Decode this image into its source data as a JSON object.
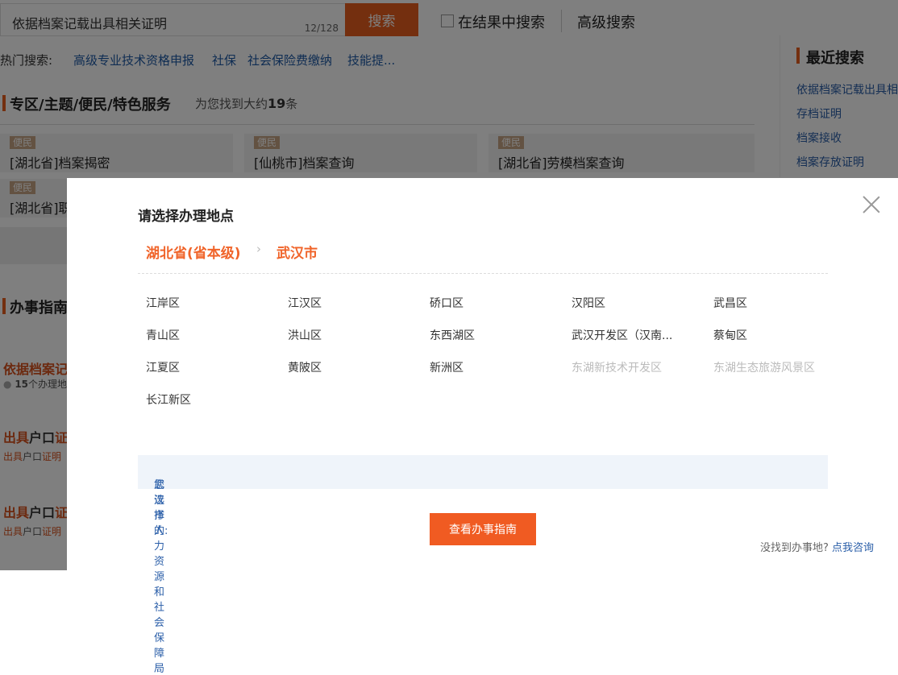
{
  "search": {
    "value": "依据档案记载出具相关证明",
    "counter": "12/128",
    "button": "搜索",
    "within_results": "在结果中搜索",
    "advanced": "高级搜索"
  },
  "hot": {
    "label": "热门搜索:",
    "links": [
      "高级专业技术资格申报",
      "社保",
      "社会保险费缴纳",
      "技能提..."
    ]
  },
  "section1": {
    "title": "专区/主题/便民/特色服务",
    "found_prefix": "为您找到大约",
    "found_count": "19",
    "found_suffix": "条"
  },
  "cards": [
    {
      "tag": "便民",
      "title": "[湖北省]档案揭密"
    },
    {
      "tag": "便民",
      "title": "[仙桃市]档案查询"
    },
    {
      "tag": "便民",
      "title": "[湖北省]劳模档案查询"
    },
    {
      "tag": "便民",
      "title": "[湖北省]职"
    }
  ],
  "section2": {
    "title": "办事指南"
  },
  "guide_items": [
    {
      "title": "依据档案记",
      "sub_count": "15",
      "sub_text": "个办理地点"
    },
    {
      "title_a": "出具",
      "title_b": "户口",
      "title_c": "证",
      "sub_a": "出具",
      "sub_b": "户口",
      "sub_c": "证明"
    },
    {
      "title_a": "出具",
      "title_b": "户口",
      "title_c": "证",
      "sub_a": "出具",
      "sub_b": "户口",
      "sub_c": "证明"
    }
  ],
  "recent": {
    "title": "最近搜索",
    "links": [
      "依据档案记载出具相",
      "存档证明",
      "档案接收",
      "档案存放证明"
    ]
  },
  "modal": {
    "title": "请选择办理地点",
    "crumb": [
      "湖北省(省本级)",
      "武汉市"
    ],
    "districts": [
      {
        "name": "江岸区",
        "disabled": false
      },
      {
        "name": "江汉区",
        "disabled": false
      },
      {
        "name": "硚口区",
        "disabled": false
      },
      {
        "name": "汉阳区",
        "disabled": false
      },
      {
        "name": "武昌区",
        "disabled": false
      },
      {
        "name": "青山区",
        "disabled": false
      },
      {
        "name": "洪山区",
        "disabled": false
      },
      {
        "name": "东西湖区",
        "disabled": false
      },
      {
        "name": "武汉开发区（汉南...",
        "disabled": false
      },
      {
        "name": "蔡甸区",
        "disabled": false
      },
      {
        "name": "江夏区",
        "disabled": false
      },
      {
        "name": "黄陂区",
        "disabled": false
      },
      {
        "name": "新洲区",
        "disabled": false
      },
      {
        "name": "东湖新技术开发区",
        "disabled": true
      },
      {
        "name": "东湖生态旅游风景区",
        "disabled": true
      },
      {
        "name": "长江新区",
        "disabled": false
      }
    ],
    "selected_label": "您选择的:",
    "selected_value": "武汉市人力资源和社会保障局",
    "view_button": "查看办事指南",
    "help_text": "没找到办事地?",
    "help_link": "点我咨询"
  },
  "colors": {
    "accent": "#e95f1f",
    "link": "#2a5ea8",
    "overlay": "rgba(0,0,0,0.5)"
  }
}
